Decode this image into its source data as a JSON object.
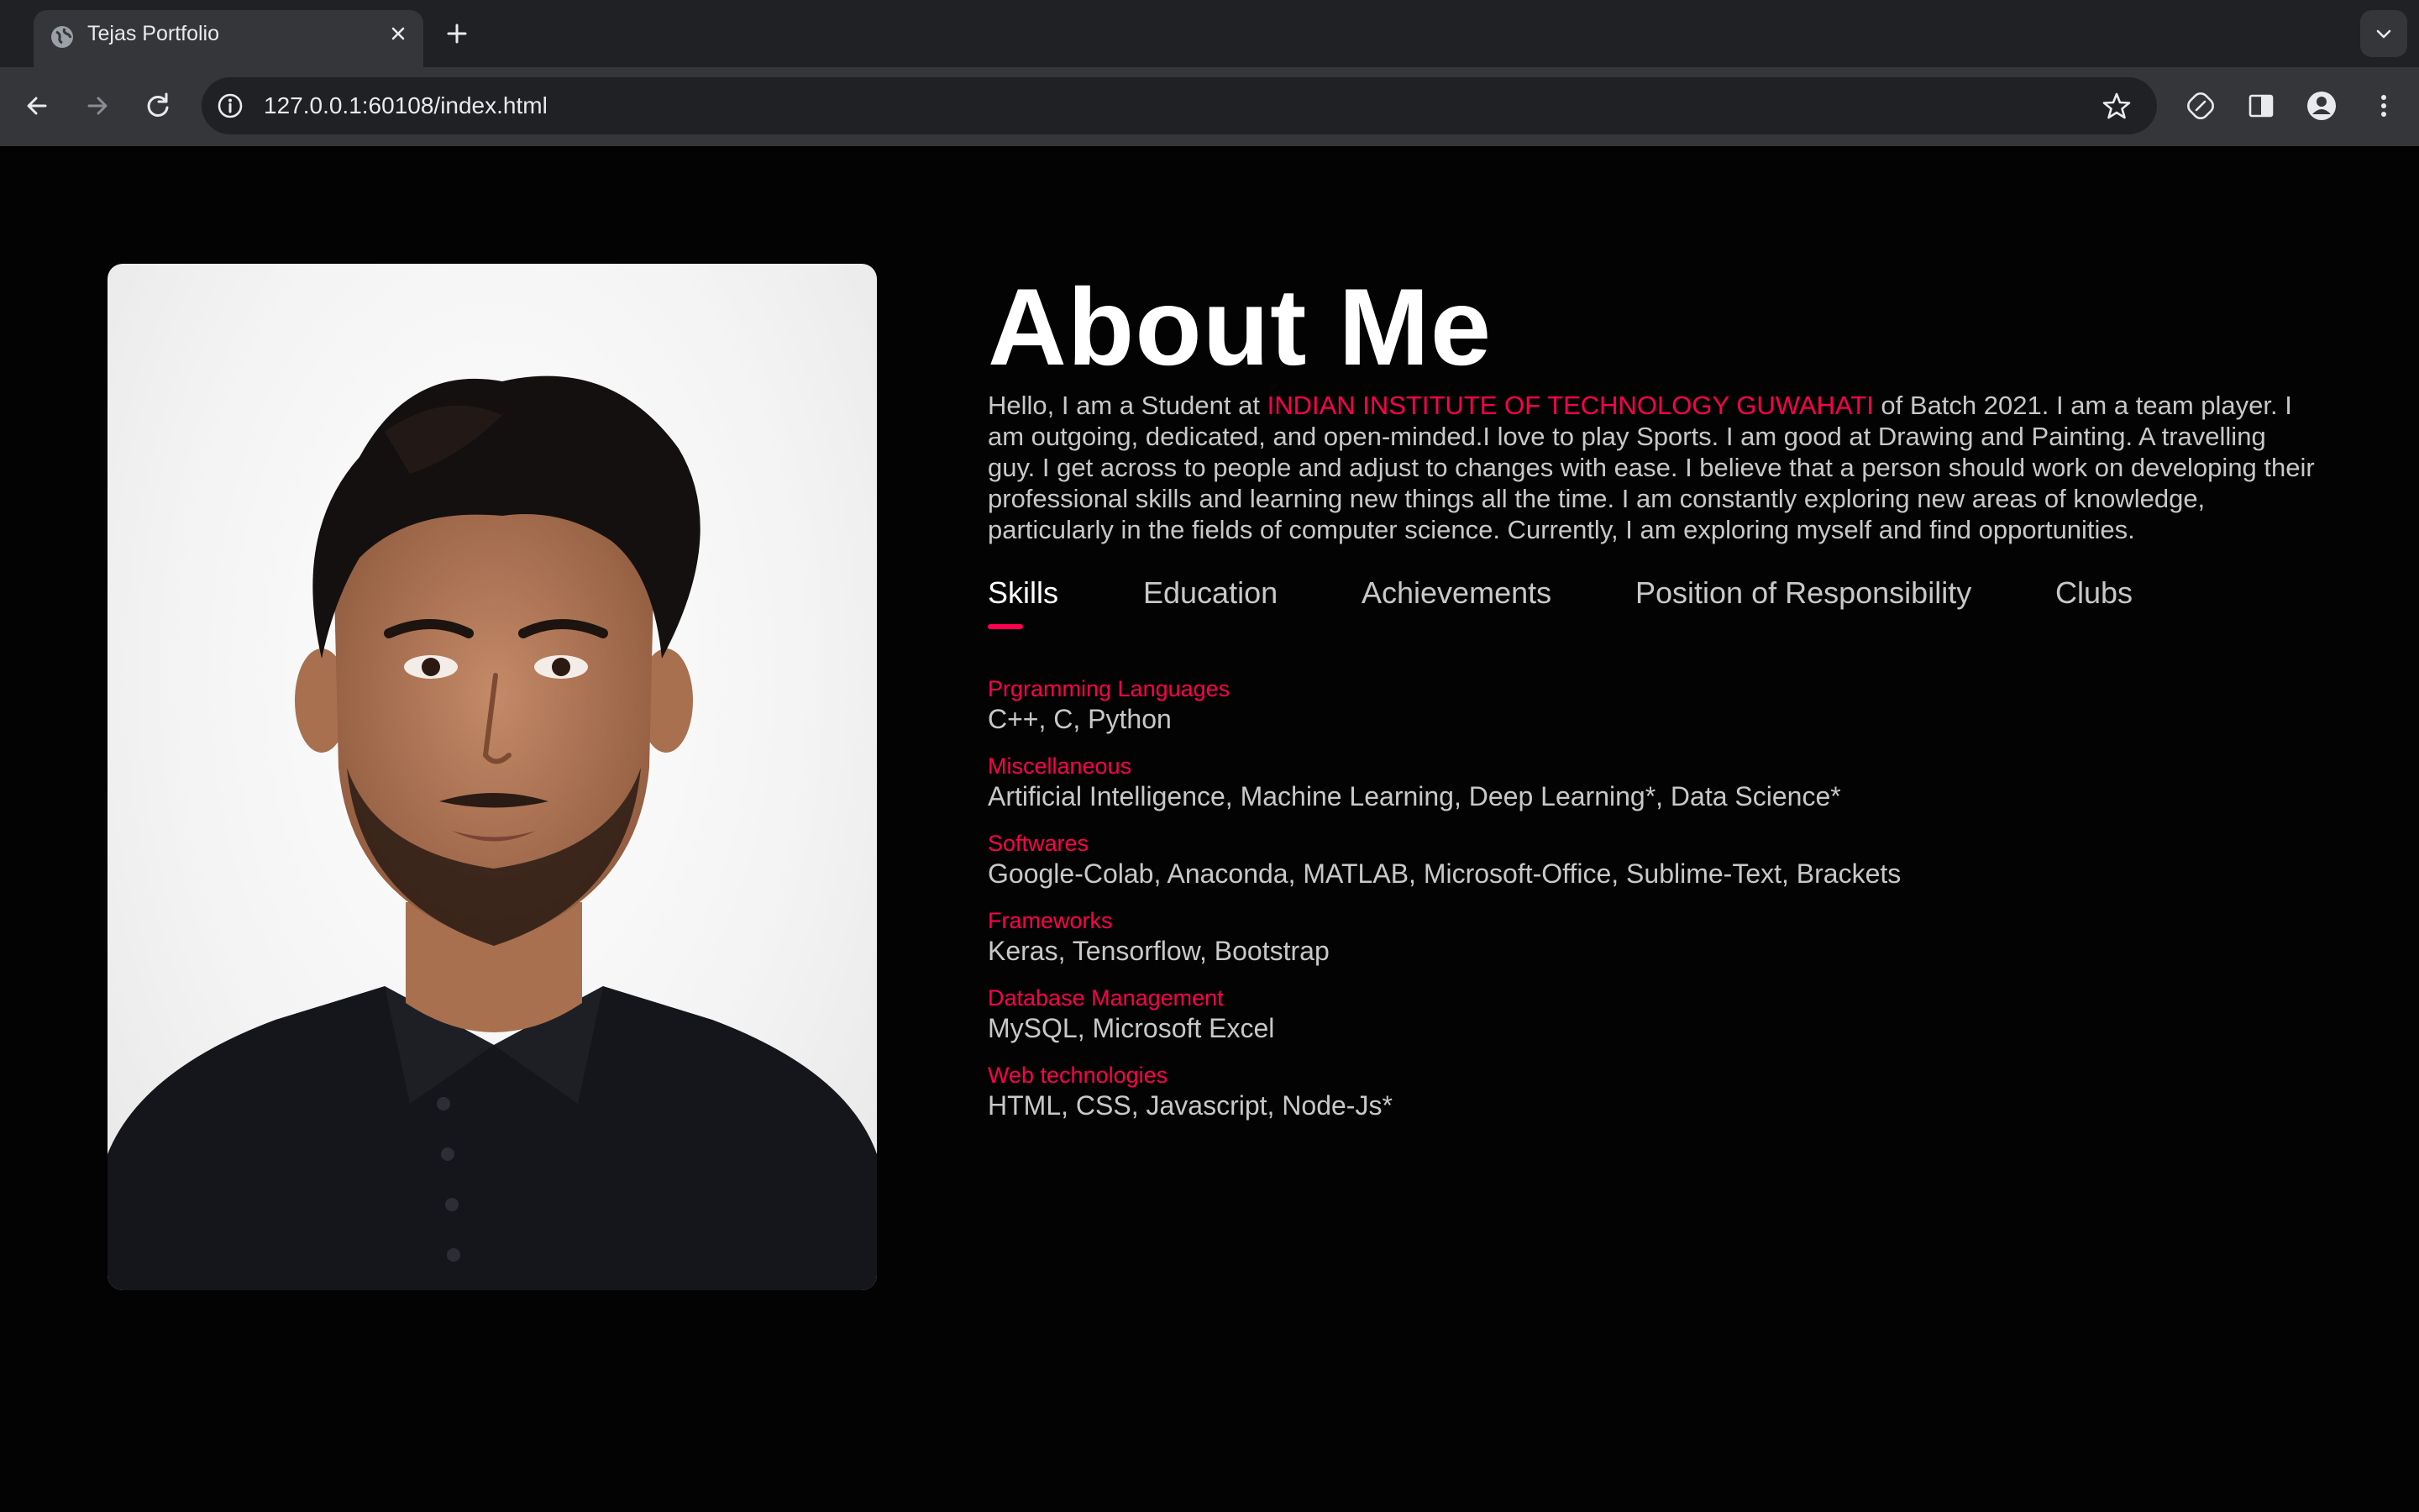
{
  "browser": {
    "tab_title": "Tejas Portfolio",
    "url": "127.0.0.1:60108/index.html"
  },
  "icons": {
    "tab": "globe-icon",
    "close": "close-icon",
    "new_tab": "plus-icon",
    "tab_search": "chevron-down-icon",
    "back": "arrow-left-icon",
    "forward": "arrow-right-icon",
    "reload": "reload-icon",
    "site_info": "info-icon",
    "bookmark": "star-icon",
    "extension": "leaf-icon",
    "side_panel": "side-panel-icon",
    "profile": "person-icon",
    "menu": "kebab-menu-icon"
  },
  "colors": {
    "accent": "#ff004f",
    "background": "#030303",
    "text": "#c8c8c8"
  },
  "about": {
    "heading": "About Me",
    "intro_before": "Hello, I am a Student at ",
    "intro_highlight": "INDIAN INSTITUTE OF TECHNOLOGY GUWAHATI",
    "intro_after": " of Batch 2021. I am a team player. I am outgoing, dedicated, and open-minded.I love to play Sports. I am good at Drawing and Painting. A travelling guy. I get across to people and adjust to changes with ease. I believe that a person should work on developing their professional skills and learning new things all the time. I am constantly exploring new areas of knowledge, particularly in the fields of computer science. Currently, I am exploring myself and find opportunities."
  },
  "tabs": [
    {
      "label": "Skills",
      "active": true
    },
    {
      "label": "Education",
      "active": false
    },
    {
      "label": "Achievements",
      "active": false
    },
    {
      "label": "Position of Responsibility",
      "active": false
    },
    {
      "label": "Clubs",
      "active": false
    }
  ],
  "skills": [
    {
      "category": "Prgramming Languages",
      "value": "C++, C, Python"
    },
    {
      "category": "Miscellaneous",
      "value": "Artificial Intelligence, Machine Learning, Deep Learning*, Data Science*"
    },
    {
      "category": "Softwares",
      "value": "Google-Colab, Anaconda, MATLAB, Microsoft-Office, Sublime-Text, Brackets"
    },
    {
      "category": "Frameworks",
      "value": "Keras, Tensorflow, Bootstrap"
    },
    {
      "category": "Database Management",
      "value": "MySQL, Microsoft Excel"
    },
    {
      "category": "Web technologies",
      "value": "HTML, CSS, Javascript, Node-Js*"
    }
  ]
}
